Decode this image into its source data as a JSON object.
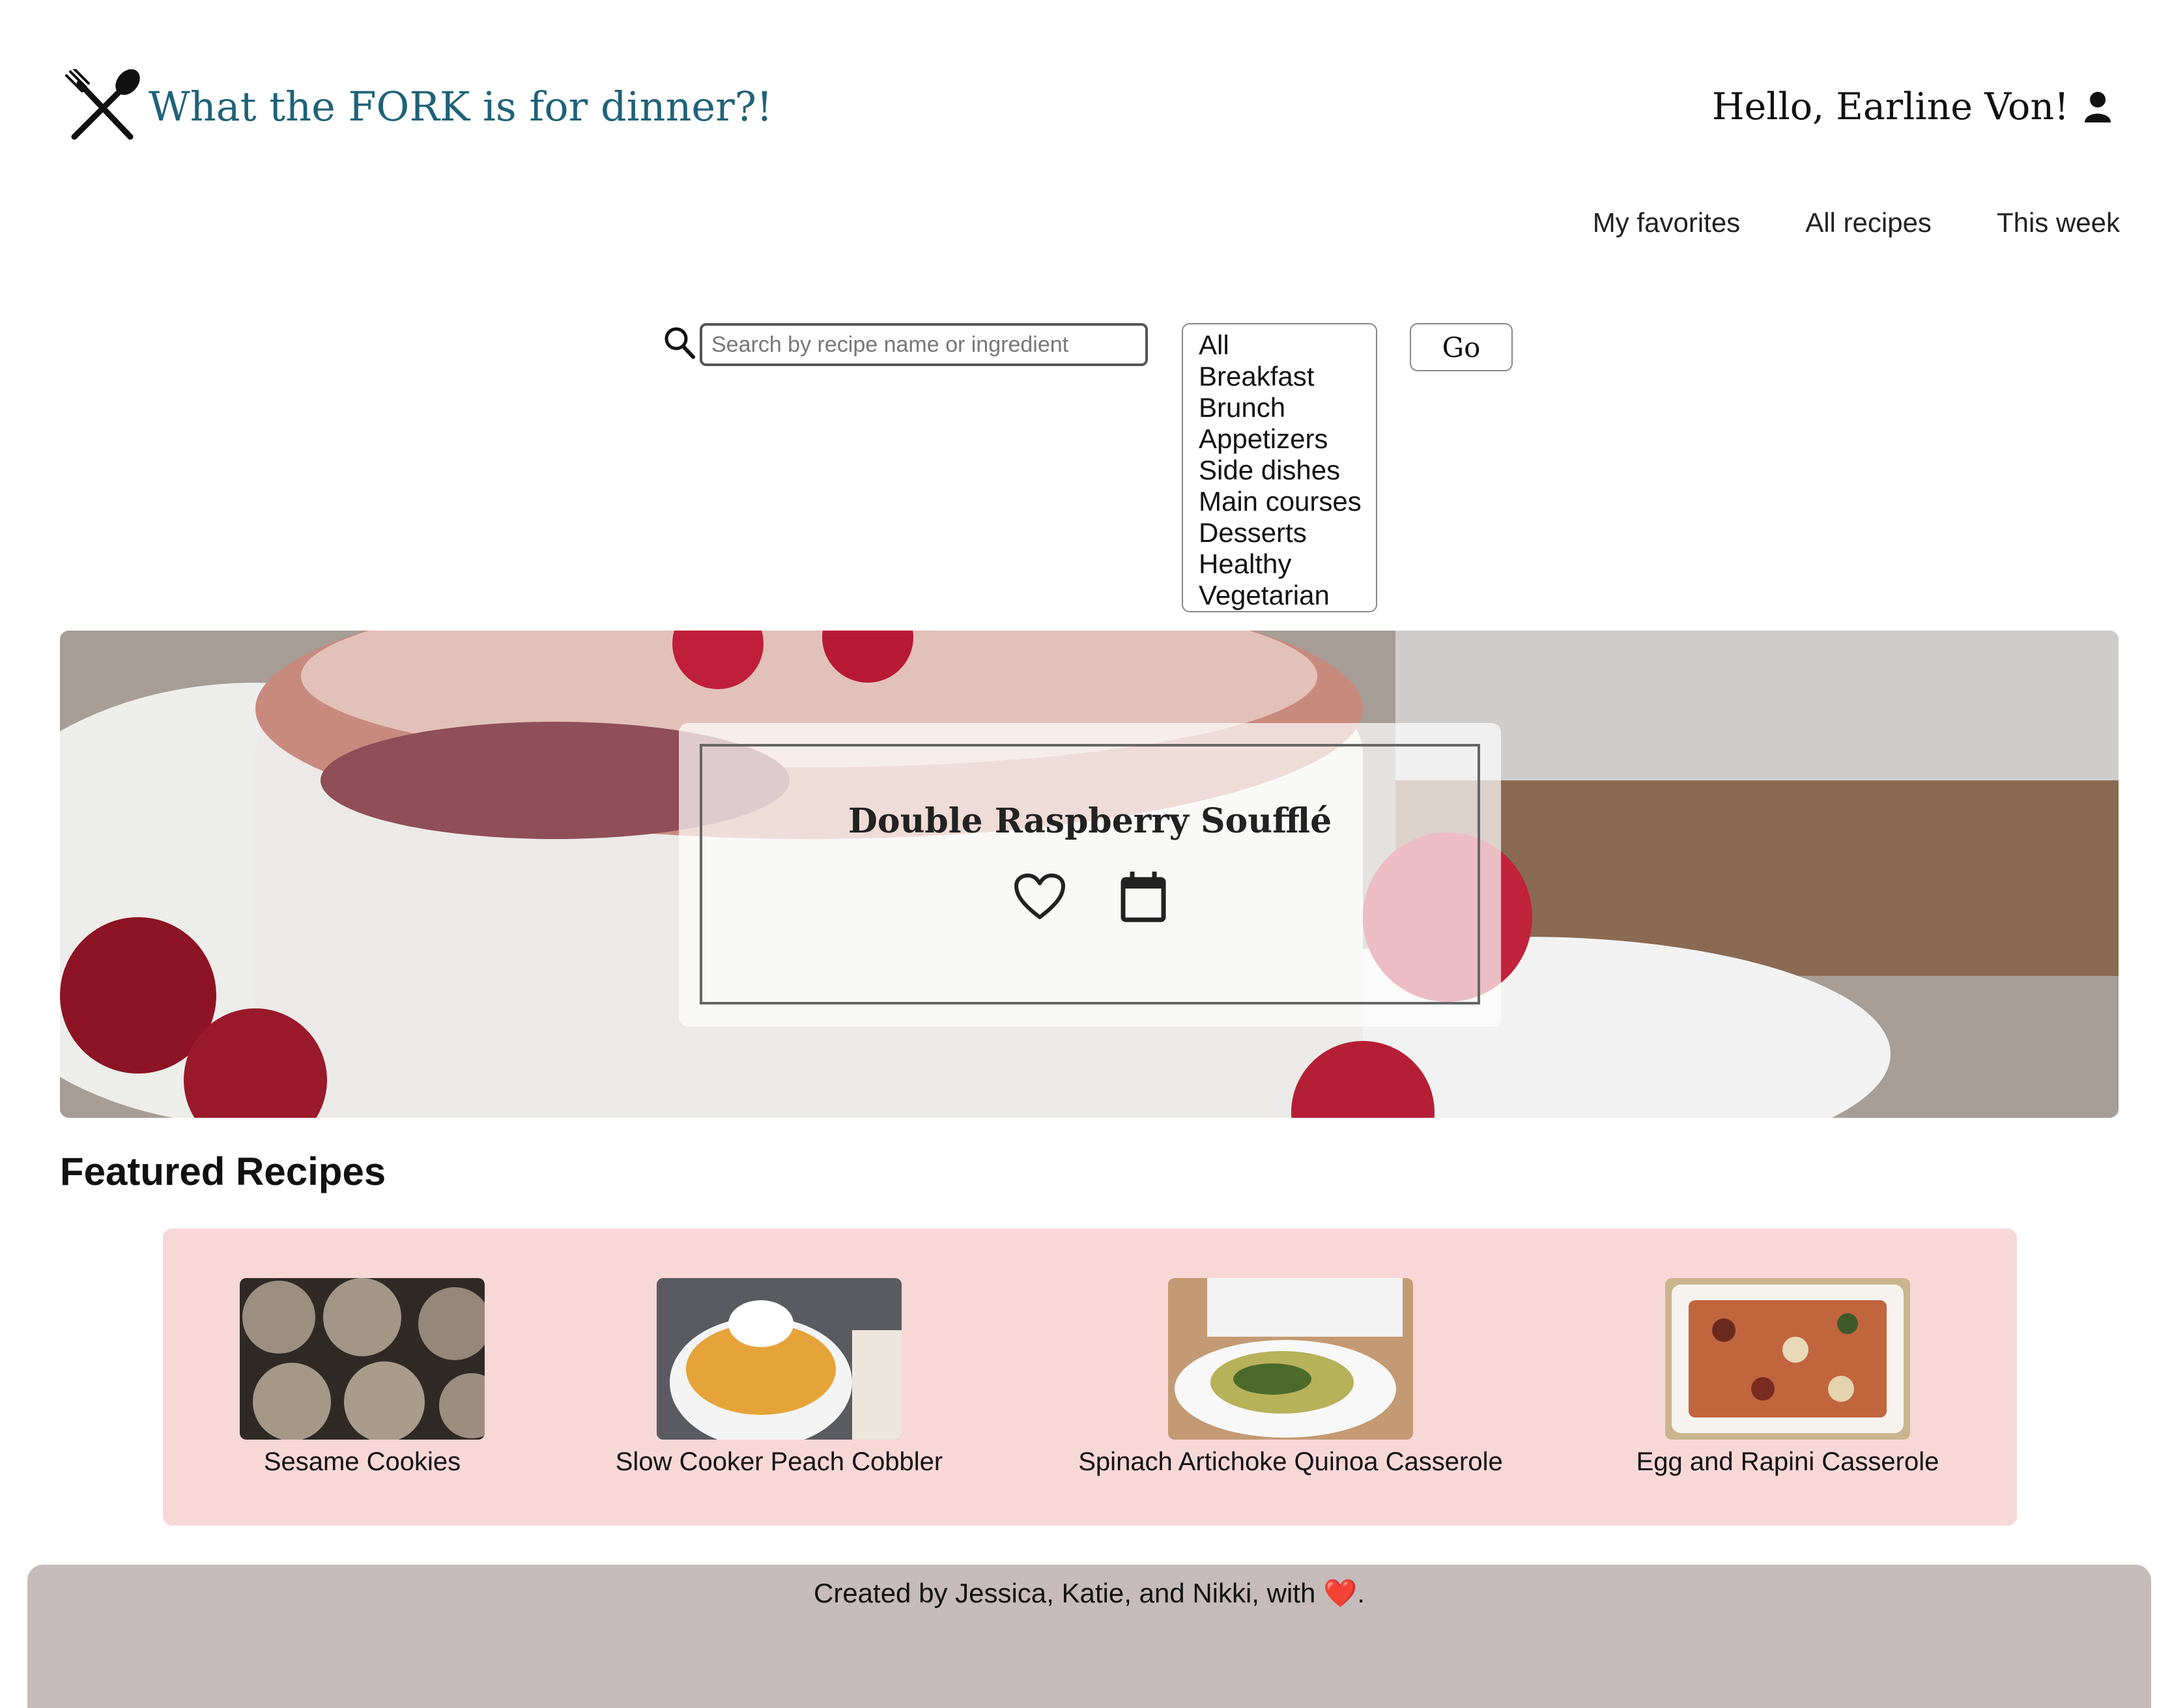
{
  "header": {
    "site_title": "What the FORK is for dinner?!",
    "greeting": "Hello, Earline Von!"
  },
  "nav": {
    "items": [
      {
        "label": "My favorites"
      },
      {
        "label": "All recipes"
      },
      {
        "label": "This week"
      }
    ]
  },
  "search": {
    "placeholder": "Search by recipe name or ingredient",
    "value": "",
    "go_label": "Go",
    "categories": [
      "All",
      "Breakfast",
      "Brunch",
      "Appetizers",
      "Side dishes",
      "Main courses",
      "Desserts",
      "Healthy",
      "Vegetarian"
    ]
  },
  "hero": {
    "title": "Double Raspberry Soufflé"
  },
  "featured": {
    "heading": "Featured Recipes",
    "recipes": [
      {
        "name": "Sesame Cookies"
      },
      {
        "name": "Slow Cooker Peach Cobbler"
      },
      {
        "name": "Spinach Artichoke Quinoa Casserole"
      },
      {
        "name": "Egg and Rapini Casserole"
      }
    ]
  },
  "footer": {
    "text": "Created by Jessica, Katie, and Nikki, with",
    "heart": "❤️",
    "end": "."
  },
  "colors": {
    "title_teal": "#1f6278",
    "featured_bg": "#f8d7d7",
    "footer_bg": "#c6bbbb"
  }
}
